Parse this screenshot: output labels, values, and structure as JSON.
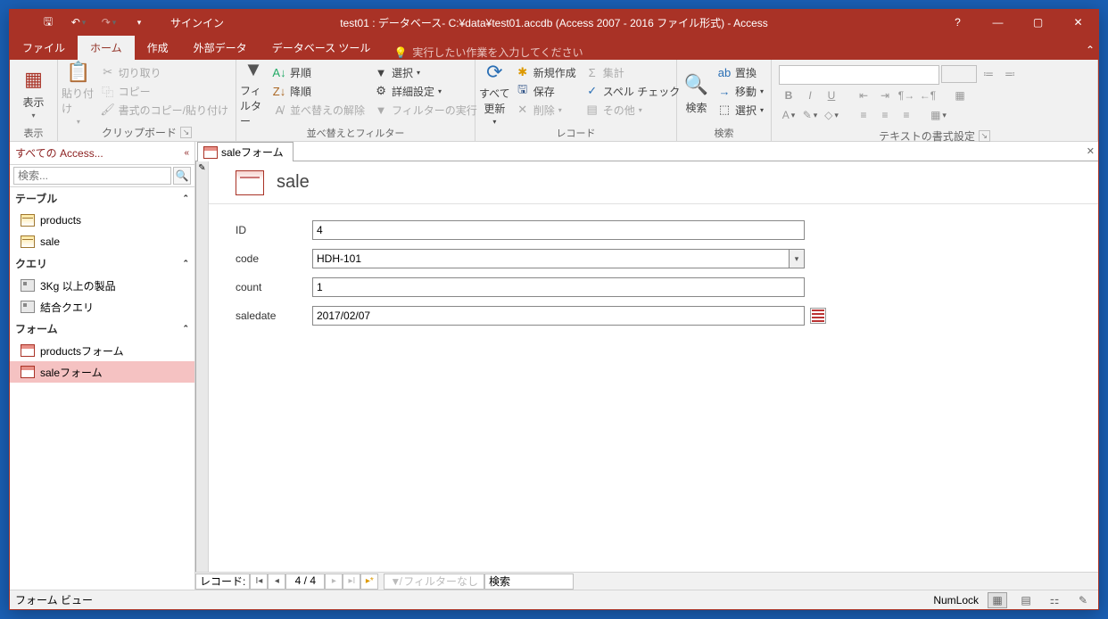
{
  "title": "test01 : データベース- C:¥data¥test01.accdb (Access 2007 - 2016 ファイル形式) - Access",
  "signin": "サインイン",
  "tabs": {
    "file": "ファイル",
    "home": "ホーム",
    "create": "作成",
    "external": "外部データ",
    "dbtools": "データベース ツール"
  },
  "tellme": "実行したい作業を入力してください",
  "ribbon": {
    "view": "表示",
    "view_group": "表示",
    "paste": "貼り付け",
    "cut": "切り取り",
    "copy": "コピー",
    "fmtpainter": "書式のコピー/貼り付け",
    "clipboard": "クリップボード",
    "filter": "フィルター",
    "asc": "昇順",
    "desc": "降順",
    "clearsort": "並べ替えの解除",
    "selection": "選択",
    "advanced": "詳細設定",
    "togglefilter": "フィルターの実行",
    "sortfilter": "並べ替えとフィルター",
    "refresh": "すべて\n更新",
    "new": "新規作成",
    "save": "保存",
    "delete": "削除",
    "totals": "集計",
    "spell": "スペル チェック",
    "more": "その他",
    "records": "レコード",
    "find": "検索",
    "replace": "置換",
    "goto": "移動",
    "select": "選択",
    "find_group": "検索",
    "textfmt": "テキストの書式設定"
  },
  "nav": {
    "header": "すべての Access...",
    "search_placeholder": "検索...",
    "groups": {
      "tables": "テーブル",
      "queries": "クエリ",
      "forms": "フォーム"
    },
    "tables": [
      "products",
      "sale"
    ],
    "queries": [
      "3Kg 以上の製品",
      "結合クエリ"
    ],
    "forms": [
      "productsフォーム",
      "saleフォーム"
    ]
  },
  "doc": {
    "tab": "saleフォーム",
    "form_title": "sale",
    "fields": {
      "id_label": "ID",
      "id_value": "4",
      "code_label": "code",
      "code_value": "HDH-101",
      "count_label": "count",
      "count_value": "1",
      "date_label": "saledate",
      "date_value": "2017/02/07"
    }
  },
  "recnav": {
    "label": "レコード:",
    "pos": "4 / 4",
    "filter": "フィルターなし",
    "search": "検索"
  },
  "status": {
    "view": "フォーム ビュー",
    "numlock": "NumLock"
  }
}
